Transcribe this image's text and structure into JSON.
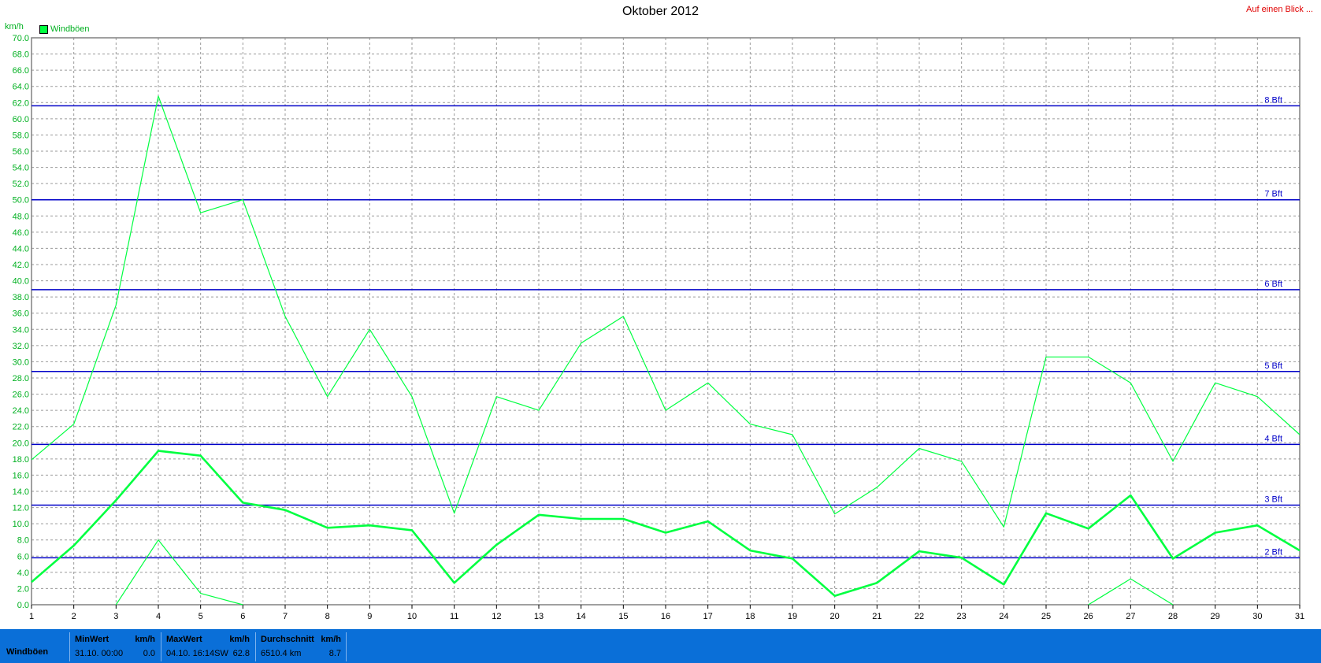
{
  "header": {
    "title": "Oktober 2012",
    "link_label": "Auf einen Blick ...",
    "unit": "km/h"
  },
  "chart_data": {
    "type": "line",
    "title": "Oktober 2012",
    "ylabel": "km/h",
    "xlabel": "",
    "x": [
      1,
      2,
      3,
      4,
      5,
      6,
      7,
      8,
      9,
      10,
      11,
      12,
      13,
      14,
      15,
      16,
      17,
      18,
      19,
      20,
      21,
      22,
      23,
      24,
      25,
      26,
      27,
      28,
      29,
      30,
      31
    ],
    "xlim": [
      1,
      31
    ],
    "ylim": [
      0,
      70
    ],
    "ytick_step": 2,
    "grid": true,
    "legend_position": "top-left",
    "legend": [
      "Windböen"
    ],
    "series": [
      {
        "name": "Windböen",
        "role": "max",
        "color": "#00ff40",
        "values": [
          17.9,
          22.3,
          37.0,
          62.8,
          48.4,
          50.0,
          35.6,
          25.7,
          34.0,
          25.7,
          11.3,
          25.7,
          24.0,
          32.3,
          35.6,
          24.0,
          27.4,
          22.3,
          21.0,
          11.2,
          14.5,
          19.3,
          17.7,
          9.6,
          30.6,
          30.6,
          27.4,
          17.7,
          27.4,
          25.7,
          21.0
        ]
      },
      {
        "name": "Windböen",
        "role": "avg",
        "color": "#00ff40",
        "values": [
          2.8,
          7.3,
          12.9,
          19.0,
          18.4,
          12.6,
          11.7,
          9.5,
          9.8,
          9.2,
          2.7,
          7.4,
          11.1,
          10.6,
          10.6,
          8.9,
          10.3,
          6.7,
          5.7,
          1.1,
          2.7,
          6.6,
          5.8,
          2.5,
          11.3,
          9.4,
          13.5,
          5.7,
          8.9,
          9.8,
          6.7
        ]
      },
      {
        "name": "Windböen",
        "role": "min",
        "color": "#00ff40",
        "values": [
          null,
          null,
          0.0,
          8.0,
          1.4,
          0.0,
          null,
          null,
          null,
          null,
          null,
          null,
          null,
          null,
          null,
          null,
          null,
          null,
          null,
          null,
          null,
          null,
          null,
          null,
          null,
          0.0,
          3.2,
          0.0,
          null,
          null,
          null
        ]
      }
    ],
    "reference_lines": [
      {
        "label": "2 Bft",
        "value": 5.8
      },
      {
        "label": "3 Bft",
        "value": 12.3
      },
      {
        "label": "4 Bft",
        "value": 19.8
      },
      {
        "label": "5 Bft",
        "value": 28.8
      },
      {
        "label": "6 Bft",
        "value": 38.9
      },
      {
        "label": "7 Bft",
        "value": 50.0
      },
      {
        "label": "8 Bft",
        "value": 61.6
      }
    ],
    "colors": {
      "series": "#00ff40",
      "axis_labels": "#00b020",
      "reference_lines": "#0000c8",
      "grid": "#9a9a9a"
    }
  },
  "stats_bar": {
    "row_label": "Windböen",
    "background": "#0a6fd8",
    "min": {
      "header": "MinWert",
      "unit": "km/h",
      "when": "31.10.  00:00",
      "value": "0.0"
    },
    "max": {
      "header": "MaxWert",
      "unit": "km/h",
      "when": "04.10.  16:14SW",
      "value": "62.8"
    },
    "avg": {
      "header": "Durchschnitt",
      "unit": "km/h",
      "when": "6510.4 km",
      "value": "8.7"
    }
  }
}
